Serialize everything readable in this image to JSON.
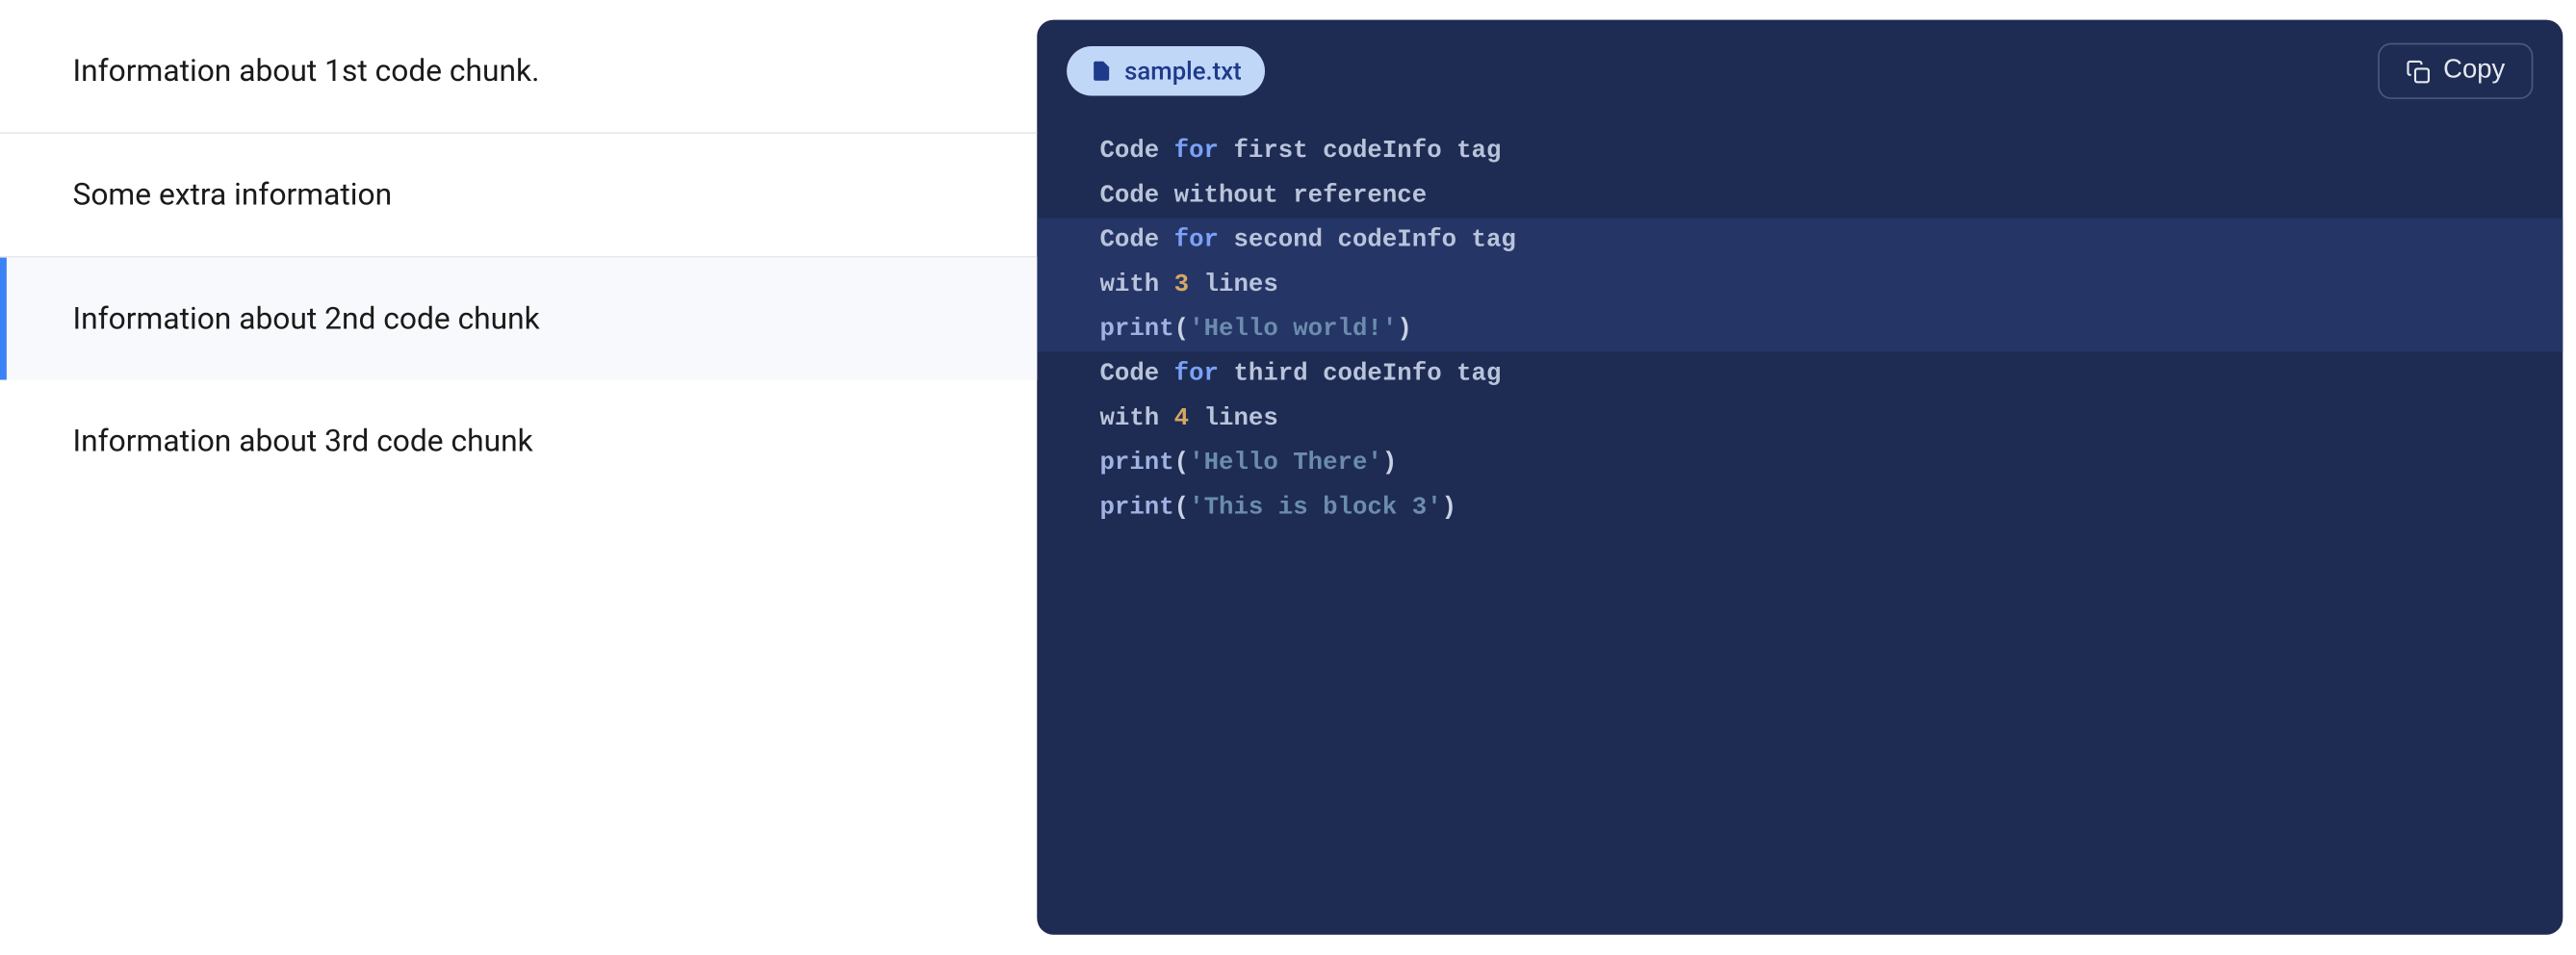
{
  "sidebar": {
    "items": [
      {
        "label": "Information about 1st code chunk.",
        "active": false
      },
      {
        "label": "Some extra information",
        "active": false
      },
      {
        "label": "Information about 2nd code chunk",
        "active": true
      },
      {
        "label": "Information about 3rd code chunk",
        "active": false
      }
    ]
  },
  "code": {
    "filename": "sample.txt",
    "copy_label": "Copy",
    "lines": [
      {
        "highlighted": false,
        "tokens": [
          {
            "t": "base",
            "v": "Code "
          },
          {
            "t": "keyword",
            "v": "for"
          },
          {
            "t": "base",
            "v": " first codeInfo tag"
          }
        ]
      },
      {
        "highlighted": false,
        "tokens": [
          {
            "t": "base",
            "v": "Code without reference"
          }
        ]
      },
      {
        "highlighted": true,
        "tokens": [
          {
            "t": "base",
            "v": "Code "
          },
          {
            "t": "keyword",
            "v": "for"
          },
          {
            "t": "base",
            "v": " second codeInfo tag"
          }
        ]
      },
      {
        "highlighted": true,
        "tokens": [
          {
            "t": "base",
            "v": "with "
          },
          {
            "t": "num",
            "v": "3"
          },
          {
            "t": "base",
            "v": " lines"
          }
        ]
      },
      {
        "highlighted": true,
        "tokens": [
          {
            "t": "func",
            "v": "print"
          },
          {
            "t": "paren",
            "v": "("
          },
          {
            "t": "string",
            "v": "'Hello world!'"
          },
          {
            "t": "paren",
            "v": ")"
          }
        ]
      },
      {
        "highlighted": false,
        "tokens": [
          {
            "t": "base",
            "v": "Code "
          },
          {
            "t": "keyword",
            "v": "for"
          },
          {
            "t": "base",
            "v": " third codeInfo tag"
          }
        ]
      },
      {
        "highlighted": false,
        "tokens": [
          {
            "t": "base",
            "v": "with "
          },
          {
            "t": "num",
            "v": "4"
          },
          {
            "t": "base",
            "v": " lines"
          }
        ]
      },
      {
        "highlighted": false,
        "tokens": [
          {
            "t": "func",
            "v": "print"
          },
          {
            "t": "paren",
            "v": "("
          },
          {
            "t": "string",
            "v": "'Hello There'"
          },
          {
            "t": "paren",
            "v": ")"
          }
        ]
      },
      {
        "highlighted": false,
        "tokens": [
          {
            "t": "func",
            "v": "print"
          },
          {
            "t": "paren",
            "v": "("
          },
          {
            "t": "string",
            "v": "'This is block 3'"
          },
          {
            "t": "paren",
            "v": ")"
          }
        ]
      }
    ]
  }
}
